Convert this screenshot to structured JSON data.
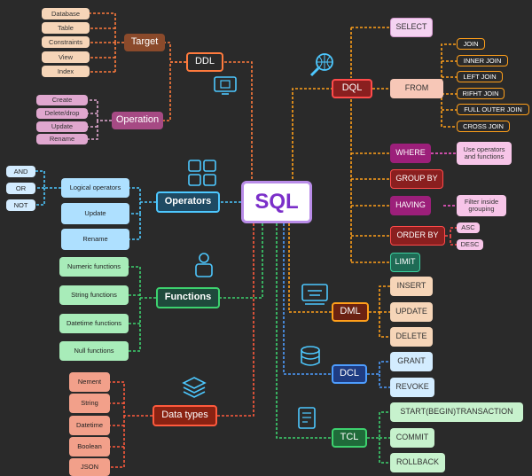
{
  "root": "SQL",
  "ddl": {
    "title": "DDL",
    "target": "Target",
    "operation": "Operation",
    "target_items": [
      "Database",
      "Table",
      "Constraints",
      "View",
      "Index"
    ],
    "operation_items": [
      "Create",
      "Delete/drop",
      "Update",
      "Rename"
    ]
  },
  "dql": {
    "title": "DQL",
    "from": "FROM",
    "clauses": [
      "SELECT",
      "WHERE",
      "GROUP BY",
      "HAVING",
      "ORDER BY",
      "LIMIT"
    ],
    "joins": [
      "JOIN",
      "INNER JOIN",
      "LEFT JOIN",
      "RIFHT JOIN",
      "FULL OUTER JOIN",
      "CROSS JOIN"
    ],
    "where_note": "Use operators and functions",
    "having_note": "Filter inside grouping",
    "order_options": [
      "ASC",
      "DESC"
    ]
  },
  "operators": {
    "title": "Operators",
    "items": [
      "Logical operators",
      "Update",
      "Rename"
    ],
    "logical": [
      "AND",
      "OR",
      "NOT"
    ]
  },
  "functions": {
    "title": "Functions",
    "items": [
      "Numeric functions",
      "String functions",
      "Datetime functions",
      "Null functions"
    ]
  },
  "datatypes": {
    "title": "Data types",
    "items": [
      "Nement",
      "String",
      "Datetime",
      "Boolean",
      "JSON"
    ]
  },
  "dml": {
    "title": "DML",
    "items": [
      "INSERT",
      "UPDATE",
      "DELETE"
    ]
  },
  "dcl": {
    "title": "DCL",
    "items": [
      "GRANT",
      "REVOKE"
    ]
  },
  "tcl": {
    "title": "TCL",
    "items": [
      "START(BEGIN)TRANSACTION",
      "COMMIT",
      "ROLLBACK"
    ]
  },
  "colors": {
    "background": "#2a2a2a",
    "root_fill": "#ffffff",
    "root_text": "#7b2fc9",
    "root_border": "#b98ce8",
    "ddl_line": "#ff7a3d",
    "ddl_leaf": "#f6d5b8",
    "ddl_hub": "#8b4a2b",
    "op_leaf": "#e0a7cf",
    "op_hub": "#a64a84",
    "dql_line": "#ff9f1a",
    "from_fill": "#f7c7b7",
    "join_fill": "#ff9f1a",
    "select_fill": "#f5d3f2",
    "where_hub": "#9c1f7a",
    "note_fill": "#f7c5e8",
    "orderby": "#8a1f1f",
    "orderby_line": "#ff4a4a",
    "limit": "#1f6b55",
    "oper_line": "#4dc8ff",
    "oper_fill": "#aee0ff",
    "oper_hub": "#1f4a63",
    "func_line": "#3dd16e",
    "func_fill": "#a8ecb9",
    "func_hub": "#1f4a3c",
    "dtype_line": "#ff5a3d",
    "dtype_fill": "#f2a08a",
    "dtype_hub": "#8a2212",
    "dml_fill": "#f6d5b8",
    "dml_hub": "#6b2212",
    "dcl_line": "#4d9dff",
    "dcl_fill": "#d3ecff",
    "dcl_hub": "#1f3c82",
    "tcl_line": "#3dd16e",
    "tcl_fill": "#c7f2cd",
    "tcl_hub": "#1f6b3a"
  }
}
